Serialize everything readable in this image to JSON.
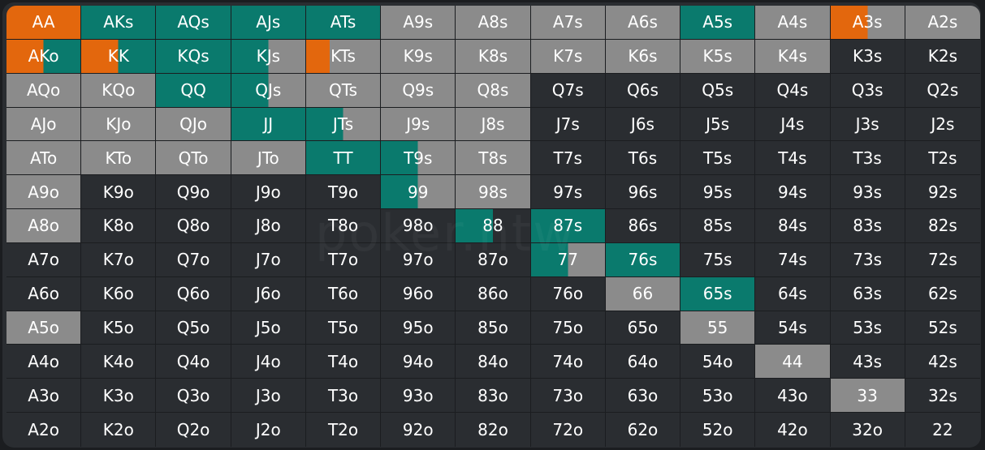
{
  "colors": {
    "raise": "#e3670d",
    "call": "#0a7a6d",
    "fold_range": "#8b8b8b",
    "empty": "#2a2d31"
  },
  "watermark": "poker.ntw",
  "rows": [
    [
      "AA",
      "AKs",
      "AQs",
      "AJs",
      "ATs",
      "A9s",
      "A8s",
      "A7s",
      "A6s",
      "A5s",
      "A4s",
      "A3s",
      "A2s"
    ],
    [
      "AKo",
      "KK",
      "KQs",
      "KJs",
      "KTs",
      "K9s",
      "K8s",
      "K7s",
      "K6s",
      "K5s",
      "K4s",
      "K3s",
      "K2s"
    ],
    [
      "AQo",
      "KQo",
      "QQ",
      "QJs",
      "QTs",
      "Q9s",
      "Q8s",
      "Q7s",
      "Q6s",
      "Q5s",
      "Q4s",
      "Q3s",
      "Q2s"
    ],
    [
      "AJo",
      "KJo",
      "QJo",
      "JJ",
      "JTs",
      "J9s",
      "J8s",
      "J7s",
      "J6s",
      "J5s",
      "J4s",
      "J3s",
      "J2s"
    ],
    [
      "ATo",
      "KTo",
      "QTo",
      "JTo",
      "TT",
      "T9s",
      "T8s",
      "T7s",
      "T6s",
      "T5s",
      "T4s",
      "T3s",
      "T2s"
    ],
    [
      "A9o",
      "K9o",
      "Q9o",
      "J9o",
      "T9o",
      "99",
      "98s",
      "97s",
      "96s",
      "95s",
      "94s",
      "93s",
      "92s"
    ],
    [
      "A8o",
      "K8o",
      "Q8o",
      "J8o",
      "T8o",
      "98o",
      "88",
      "87s",
      "86s",
      "85s",
      "84s",
      "83s",
      "82s"
    ],
    [
      "A7o",
      "K7o",
      "Q7o",
      "J7o",
      "T7o",
      "97o",
      "87o",
      "77",
      "76s",
      "75s",
      "74s",
      "73s",
      "72s"
    ],
    [
      "A6o",
      "K6o",
      "Q6o",
      "J6o",
      "T6o",
      "96o",
      "86o",
      "76o",
      "66",
      "65s",
      "64s",
      "63s",
      "62s"
    ],
    [
      "A5o",
      "K5o",
      "Q5o",
      "J5o",
      "T5o",
      "95o",
      "85o",
      "75o",
      "65o",
      "55",
      "54s",
      "53s",
      "52s"
    ],
    [
      "A4o",
      "K4o",
      "Q4o",
      "J4o",
      "T4o",
      "94o",
      "84o",
      "74o",
      "64o",
      "54o",
      "44",
      "43s",
      "42s"
    ],
    [
      "A3o",
      "K3o",
      "Q3o",
      "J3o",
      "T3o",
      "93o",
      "83o",
      "73o",
      "63o",
      "53o",
      "43o",
      "33",
      "32s"
    ],
    [
      "A2o",
      "K2o",
      "Q2o",
      "J2o",
      "T2o",
      "92o",
      "82o",
      "72o",
      "62o",
      "52o",
      "42o",
      "32o",
      "22"
    ]
  ],
  "ranges": {
    "AA": {
      "raise": 1.0
    },
    "AKs": {
      "call": 1.0
    },
    "AQs": {
      "call": 1.0
    },
    "AJs": {
      "call": 1.0
    },
    "ATs": {
      "call": 1.0
    },
    "A9s": {
      "fold_range": 1.0
    },
    "A8s": {
      "fold_range": 1.0
    },
    "A7s": {
      "fold_range": 1.0
    },
    "A6s": {
      "fold_range": 1.0
    },
    "A5s": {
      "call": 1.0
    },
    "A4s": {
      "fold_range": 1.0
    },
    "A3s": {
      "raise": 0.5,
      "fold_range": 0.5
    },
    "A2s": {
      "fold_range": 1.0
    },
    "AKo": {
      "raise": 0.5,
      "call": 0.5
    },
    "KK": {
      "raise": 0.5,
      "call": 0.5
    },
    "KQs": {
      "call": 1.0
    },
    "KJs": {
      "call": 0.5,
      "fold_range": 0.5
    },
    "KTs": {
      "raise": 0.32,
      "fold_range": 0.68
    },
    "K9s": {
      "fold_range": 1.0
    },
    "K8s": {
      "fold_range": 1.0
    },
    "K7s": {
      "fold_range": 1.0
    },
    "K6s": {
      "fold_range": 1.0
    },
    "K5s": {
      "fold_range": 1.0
    },
    "K4s": {
      "fold_range": 1.0
    },
    "AQo": {
      "fold_range": 1.0
    },
    "KQo": {
      "fold_range": 1.0
    },
    "QQ": {
      "call": 1.0
    },
    "QJs": {
      "call": 0.5,
      "fold_range": 0.5
    },
    "QTs": {
      "fold_range": 1.0
    },
    "Q9s": {
      "fold_range": 1.0
    },
    "Q8s": {
      "fold_range": 1.0
    },
    "AJo": {
      "fold_range": 1.0
    },
    "KJo": {
      "fold_range": 1.0
    },
    "QJo": {
      "fold_range": 1.0
    },
    "JJ": {
      "call": 1.0
    },
    "JTs": {
      "call": 0.5,
      "fold_range": 0.5
    },
    "J9s": {
      "fold_range": 1.0
    },
    "J8s": {
      "fold_range": 1.0
    },
    "ATo": {
      "fold_range": 1.0
    },
    "KTo": {
      "fold_range": 1.0
    },
    "QTo": {
      "fold_range": 1.0
    },
    "JTo": {
      "fold_range": 1.0
    },
    "TT": {
      "call": 1.0
    },
    "T9s": {
      "call": 0.5,
      "fold_range": 0.5
    },
    "T8s": {
      "fold_range": 1.0
    },
    "A9o": {
      "fold_range": 1.0
    },
    "99": {
      "call": 0.5,
      "fold_range": 0.5
    },
    "98s": {
      "fold_range": 1.0
    },
    "A8o": {
      "fold_range": 1.0
    },
    "88": {
      "call": 0.5,
      "empty": 0.5
    },
    "87s": {
      "call": 1.0
    },
    "77": {
      "call": 0.5,
      "fold_range": 0.5
    },
    "76s": {
      "call": 1.0
    },
    "66": {
      "fold_range": 1.0
    },
    "65s": {
      "call": 1.0
    },
    "A5o": {
      "fold_range": 1.0
    },
    "55": {
      "fold_range": 1.0
    },
    "44": {
      "fold_range": 1.0
    },
    "33": {
      "fold_range": 1.0
    }
  }
}
